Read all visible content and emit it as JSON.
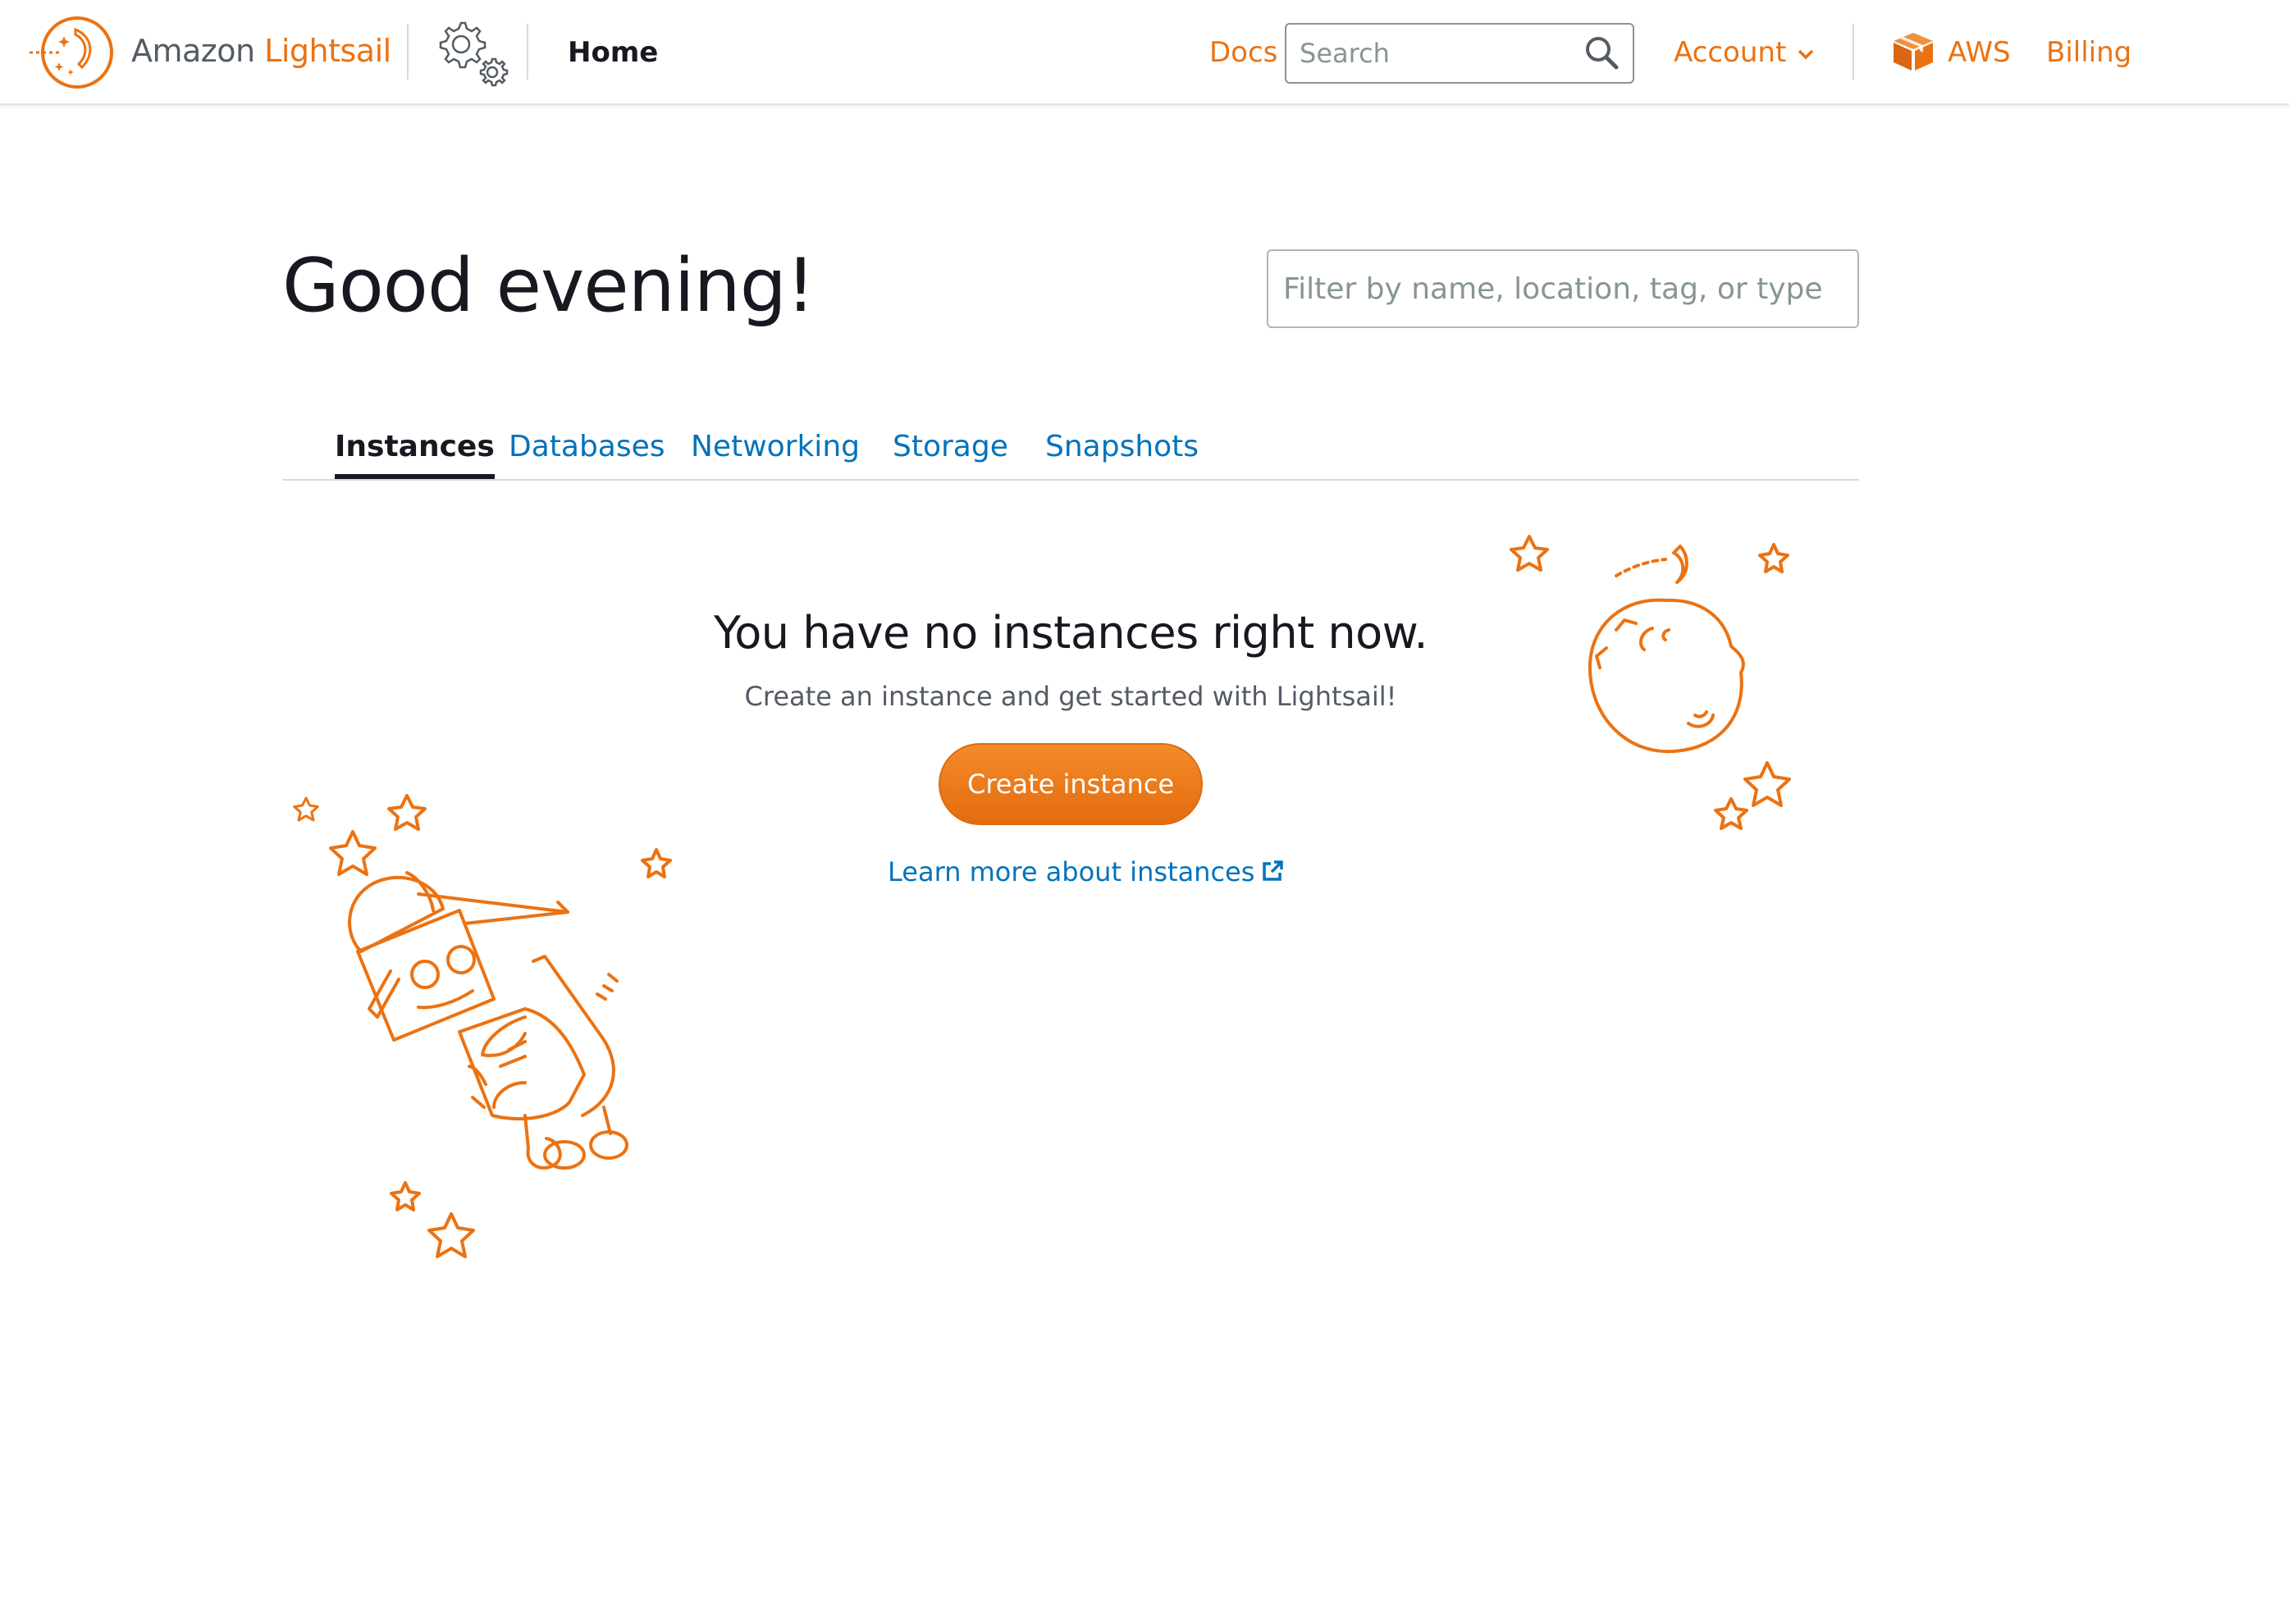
{
  "header": {
    "brand_prefix": "Amazon ",
    "brand_name": "Lightsail",
    "home_label": "Home",
    "docs_label": "Docs",
    "search_placeholder": "Search",
    "account_label": "Account",
    "aws_label": "AWS",
    "billing_label": "Billing"
  },
  "main": {
    "greeting": "Good evening!",
    "filter_placeholder": "Filter by name, location, tag, or type",
    "tabs": [
      {
        "label": "Instances",
        "active": true
      },
      {
        "label": "Databases",
        "active": false
      },
      {
        "label": "Networking",
        "active": false
      },
      {
        "label": "Storage",
        "active": false
      },
      {
        "label": "Snapshots",
        "active": false
      }
    ],
    "empty_state": {
      "title": "You have no instances right now.",
      "subtitle": "Create an instance and get started with Lightsail!",
      "create_button": "Create instance",
      "learn_more": "Learn more about instances"
    }
  },
  "icons": {
    "logo": "lightsail-logo-icon",
    "gears": "gears-icon",
    "search": "search-icon",
    "chevron": "chevron-down-icon",
    "aws": "aws-cube-icon",
    "external": "external-link-icon"
  },
  "colors": {
    "accent": "#ec7211",
    "link": "#0073bb",
    "text": "#16191f",
    "muted": "#545b64"
  }
}
